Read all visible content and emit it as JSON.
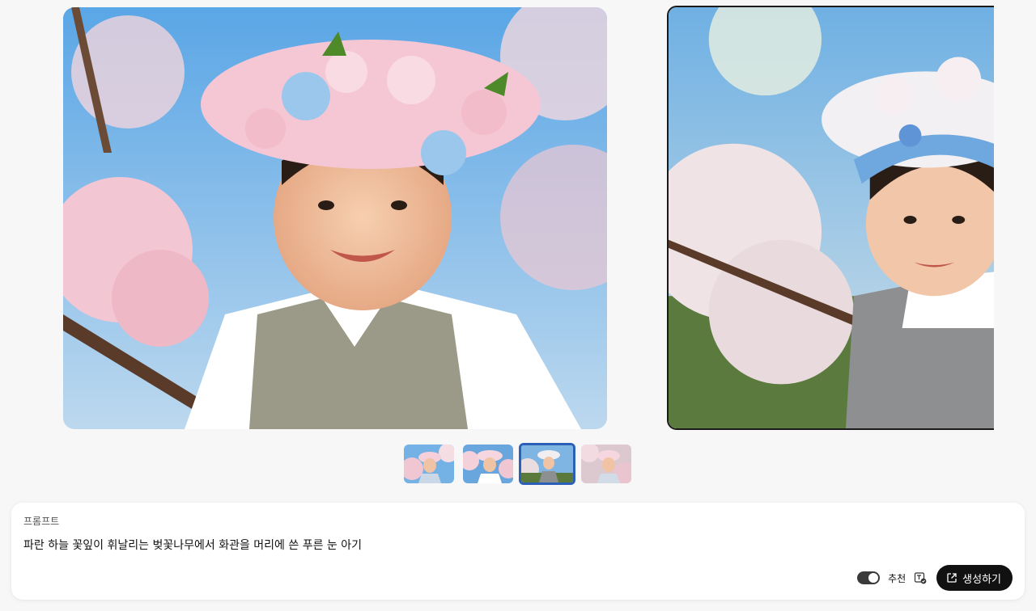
{
  "gallery": {
    "main_image_alt": "",
    "thumbnails": [
      {
        "selected": false
      },
      {
        "selected": false
      },
      {
        "selected": true
      },
      {
        "selected": false
      }
    ]
  },
  "prompt": {
    "label": "프롬프트",
    "text": "파란 하늘 꽃잎이 휘날리는 벚꽃나무에서 화관을 머리에 쓴 푸른 눈 아기"
  },
  "controls": {
    "recommend_label": "추천",
    "recommend_toggle_on": true,
    "generate_label": "생성하기"
  },
  "icons": {
    "recommend": "prompt-suggest-icon",
    "generate": "external-edit-icon"
  },
  "colors": {
    "background": "#f7f7f7",
    "selected_thumb_border": "#2c5fb8",
    "button_bg": "#111111"
  }
}
